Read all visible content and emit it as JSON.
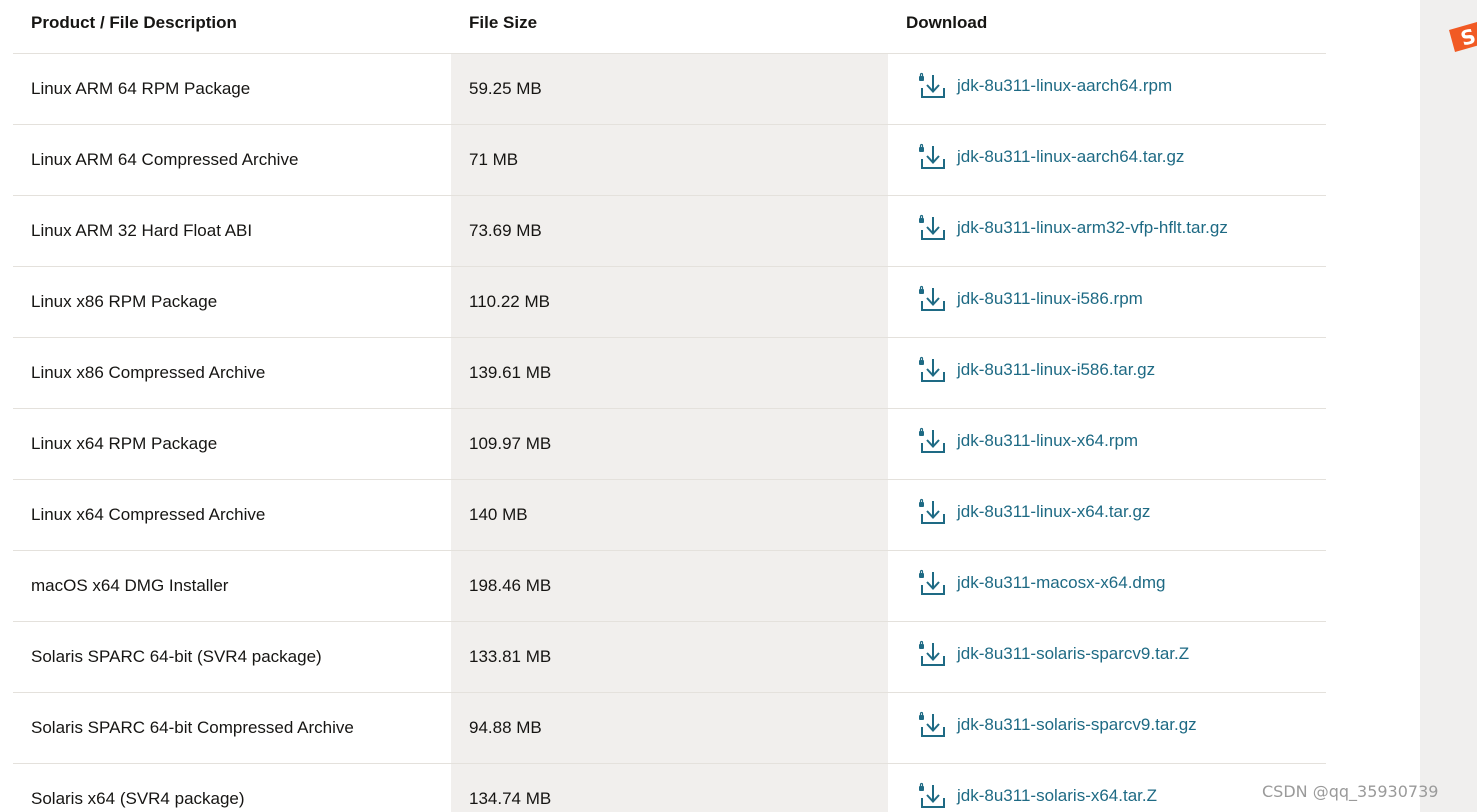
{
  "table": {
    "headers": {
      "product": "Product / File Description",
      "size": "File Size",
      "download": "Download"
    },
    "rows": [
      {
        "product": "Linux ARM 64 RPM Package",
        "size": "59.25 MB",
        "file": "jdk-8u311-linux-aarch64.rpm"
      },
      {
        "product": "Linux ARM 64 Compressed Archive",
        "size": "71 MB",
        "file": "jdk-8u311-linux-aarch64.tar.gz"
      },
      {
        "product": "Linux ARM 32 Hard Float ABI",
        "size": "73.69 MB",
        "file": "jdk-8u311-linux-arm32-vfp-hflt.tar.gz"
      },
      {
        "product": "Linux x86 RPM Package",
        "size": "110.22 MB",
        "file": "jdk-8u311-linux-i586.rpm"
      },
      {
        "product": "Linux x86 Compressed Archive",
        "size": "139.61 MB",
        "file": "jdk-8u311-linux-i586.tar.gz"
      },
      {
        "product": "Linux x64 RPM Package",
        "size": "109.97 MB",
        "file": "jdk-8u311-linux-x64.rpm"
      },
      {
        "product": "Linux x64 Compressed Archive",
        "size": "140 MB",
        "file": "jdk-8u311-linux-x64.tar.gz"
      },
      {
        "product": "macOS x64 DMG Installer",
        "size": "198.46 MB",
        "file": "jdk-8u311-macosx-x64.dmg"
      },
      {
        "product": "Solaris SPARC 64-bit (SVR4 package)",
        "size": "133.81 MB",
        "file": "jdk-8u311-solaris-sparcv9.tar.Z"
      },
      {
        "product": "Solaris SPARC 64-bit Compressed Archive",
        "size": "94.88 MB",
        "file": "jdk-8u311-solaris-sparcv9.tar.gz"
      },
      {
        "product": "Solaris x64 (SVR4 package)",
        "size": "134.74 MB",
        "file": "jdk-8u311-solaris-x64.tar.Z"
      }
    ]
  },
  "icons": {
    "row_icon": "download-lock-icon",
    "logo": "csdn-logo-icon"
  },
  "colors": {
    "link": "#1e6a84",
    "size_column_bg": "#f1efed",
    "logo": "#f15a24"
  },
  "watermark": "CSDN @qq_35930739"
}
